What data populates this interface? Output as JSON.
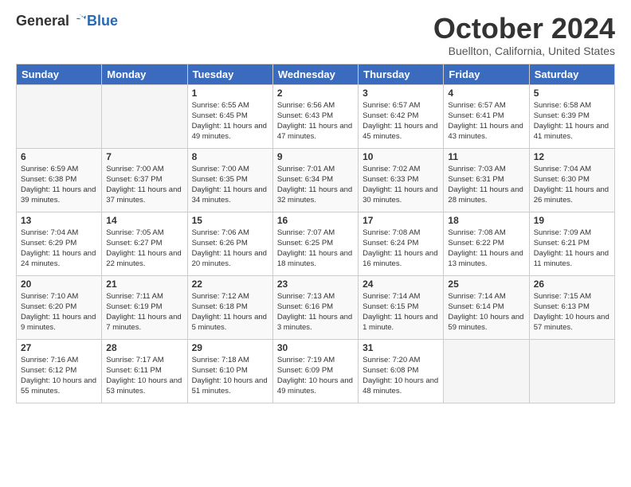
{
  "header": {
    "logo_general": "General",
    "logo_blue": "Blue",
    "month_title": "October 2024",
    "location": "Buellton, California, United States"
  },
  "weekdays": [
    "Sunday",
    "Monday",
    "Tuesday",
    "Wednesday",
    "Thursday",
    "Friday",
    "Saturday"
  ],
  "weeks": [
    [
      {
        "day": "",
        "info": ""
      },
      {
        "day": "",
        "info": ""
      },
      {
        "day": "1",
        "info": "Sunrise: 6:55 AM\nSunset: 6:45 PM\nDaylight: 11 hours and 49 minutes."
      },
      {
        "day": "2",
        "info": "Sunrise: 6:56 AM\nSunset: 6:43 PM\nDaylight: 11 hours and 47 minutes."
      },
      {
        "day": "3",
        "info": "Sunrise: 6:57 AM\nSunset: 6:42 PM\nDaylight: 11 hours and 45 minutes."
      },
      {
        "day": "4",
        "info": "Sunrise: 6:57 AM\nSunset: 6:41 PM\nDaylight: 11 hours and 43 minutes."
      },
      {
        "day": "5",
        "info": "Sunrise: 6:58 AM\nSunset: 6:39 PM\nDaylight: 11 hours and 41 minutes."
      }
    ],
    [
      {
        "day": "6",
        "info": "Sunrise: 6:59 AM\nSunset: 6:38 PM\nDaylight: 11 hours and 39 minutes."
      },
      {
        "day": "7",
        "info": "Sunrise: 7:00 AM\nSunset: 6:37 PM\nDaylight: 11 hours and 37 minutes."
      },
      {
        "day": "8",
        "info": "Sunrise: 7:00 AM\nSunset: 6:35 PM\nDaylight: 11 hours and 34 minutes."
      },
      {
        "day": "9",
        "info": "Sunrise: 7:01 AM\nSunset: 6:34 PM\nDaylight: 11 hours and 32 minutes."
      },
      {
        "day": "10",
        "info": "Sunrise: 7:02 AM\nSunset: 6:33 PM\nDaylight: 11 hours and 30 minutes."
      },
      {
        "day": "11",
        "info": "Sunrise: 7:03 AM\nSunset: 6:31 PM\nDaylight: 11 hours and 28 minutes."
      },
      {
        "day": "12",
        "info": "Sunrise: 7:04 AM\nSunset: 6:30 PM\nDaylight: 11 hours and 26 minutes."
      }
    ],
    [
      {
        "day": "13",
        "info": "Sunrise: 7:04 AM\nSunset: 6:29 PM\nDaylight: 11 hours and 24 minutes."
      },
      {
        "day": "14",
        "info": "Sunrise: 7:05 AM\nSunset: 6:27 PM\nDaylight: 11 hours and 22 minutes."
      },
      {
        "day": "15",
        "info": "Sunrise: 7:06 AM\nSunset: 6:26 PM\nDaylight: 11 hours and 20 minutes."
      },
      {
        "day": "16",
        "info": "Sunrise: 7:07 AM\nSunset: 6:25 PM\nDaylight: 11 hours and 18 minutes."
      },
      {
        "day": "17",
        "info": "Sunrise: 7:08 AM\nSunset: 6:24 PM\nDaylight: 11 hours and 16 minutes."
      },
      {
        "day": "18",
        "info": "Sunrise: 7:08 AM\nSunset: 6:22 PM\nDaylight: 11 hours and 13 minutes."
      },
      {
        "day": "19",
        "info": "Sunrise: 7:09 AM\nSunset: 6:21 PM\nDaylight: 11 hours and 11 minutes."
      }
    ],
    [
      {
        "day": "20",
        "info": "Sunrise: 7:10 AM\nSunset: 6:20 PM\nDaylight: 11 hours and 9 minutes."
      },
      {
        "day": "21",
        "info": "Sunrise: 7:11 AM\nSunset: 6:19 PM\nDaylight: 11 hours and 7 minutes."
      },
      {
        "day": "22",
        "info": "Sunrise: 7:12 AM\nSunset: 6:18 PM\nDaylight: 11 hours and 5 minutes."
      },
      {
        "day": "23",
        "info": "Sunrise: 7:13 AM\nSunset: 6:16 PM\nDaylight: 11 hours and 3 minutes."
      },
      {
        "day": "24",
        "info": "Sunrise: 7:14 AM\nSunset: 6:15 PM\nDaylight: 11 hours and 1 minute."
      },
      {
        "day": "25",
        "info": "Sunrise: 7:14 AM\nSunset: 6:14 PM\nDaylight: 10 hours and 59 minutes."
      },
      {
        "day": "26",
        "info": "Sunrise: 7:15 AM\nSunset: 6:13 PM\nDaylight: 10 hours and 57 minutes."
      }
    ],
    [
      {
        "day": "27",
        "info": "Sunrise: 7:16 AM\nSunset: 6:12 PM\nDaylight: 10 hours and 55 minutes."
      },
      {
        "day": "28",
        "info": "Sunrise: 7:17 AM\nSunset: 6:11 PM\nDaylight: 10 hours and 53 minutes."
      },
      {
        "day": "29",
        "info": "Sunrise: 7:18 AM\nSunset: 6:10 PM\nDaylight: 10 hours and 51 minutes."
      },
      {
        "day": "30",
        "info": "Sunrise: 7:19 AM\nSunset: 6:09 PM\nDaylight: 10 hours and 49 minutes."
      },
      {
        "day": "31",
        "info": "Sunrise: 7:20 AM\nSunset: 6:08 PM\nDaylight: 10 hours and 48 minutes."
      },
      {
        "day": "",
        "info": ""
      },
      {
        "day": "",
        "info": ""
      }
    ]
  ]
}
